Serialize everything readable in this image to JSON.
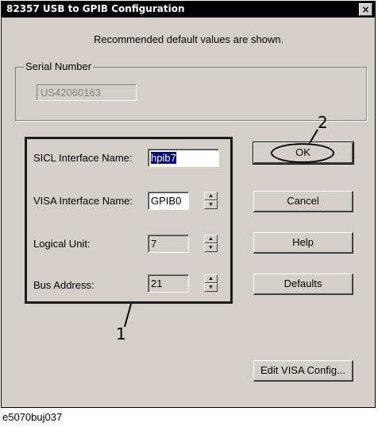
{
  "window": {
    "title": "82357 USB to GPIB Configuration",
    "close_label": "×"
  },
  "intro_text": "Recommended default values are shown.",
  "serial": {
    "group_label": "Serial Number",
    "value": "US42060163"
  },
  "fields": {
    "sicl": {
      "label": "SICL Interface Name:",
      "value": "hpib7"
    },
    "visa": {
      "label": "VISA Interface Name:",
      "value": "GPIB0"
    },
    "logical_unit": {
      "label": "Logical Unit:",
      "value": "7"
    },
    "bus_address": {
      "label": "Bus Address:",
      "value": "21"
    }
  },
  "buttons": {
    "ok": "OK",
    "cancel": "Cancel",
    "help": "Help",
    "defaults": "Defaults",
    "edit_visa": "Edit VISA Config..."
  },
  "callouts": {
    "one": "1",
    "two": "2"
  },
  "caption": "e5070buj037",
  "icons": {
    "close": "close-icon",
    "spin_up": "spin-up-arrow-icon",
    "spin_down": "spin-down-arrow-icon"
  }
}
